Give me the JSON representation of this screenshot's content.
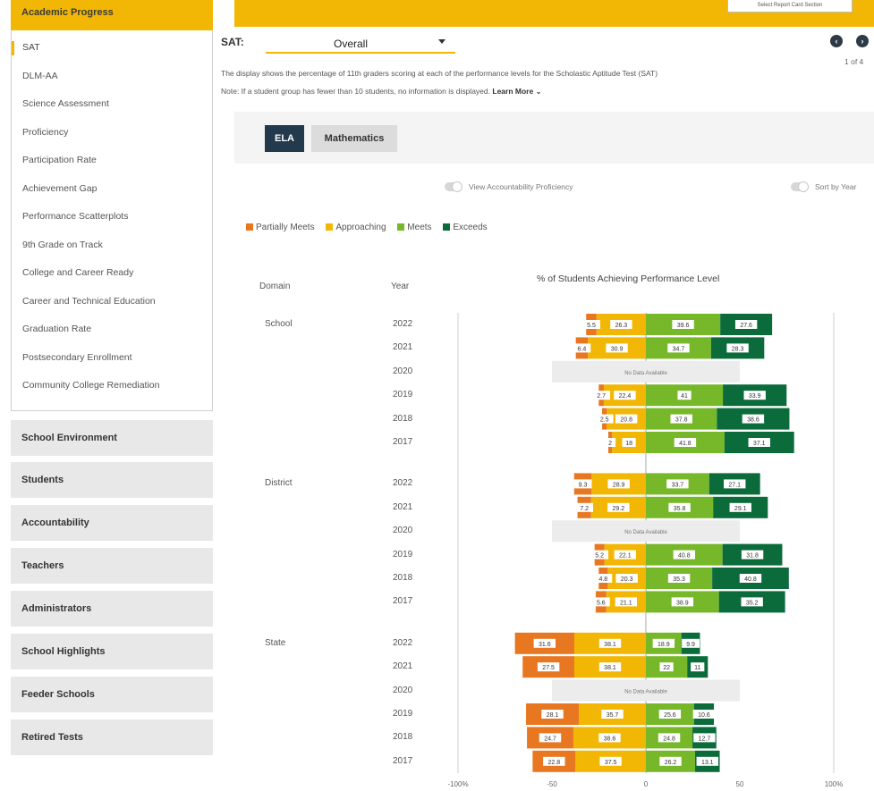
{
  "sidebar": {
    "section_title": "Academic Progress",
    "items": [
      {
        "label": "SAT",
        "active": true
      },
      {
        "label": "DLM-AA"
      },
      {
        "label": "Science Assessment"
      },
      {
        "label": "Proficiency"
      },
      {
        "label": "Participation Rate"
      },
      {
        "label": "Achievement Gap"
      },
      {
        "label": "Performance Scatterplots"
      },
      {
        "label": "9th Grade on Track"
      },
      {
        "label": "College and Career Ready"
      },
      {
        "label": "Career and Technical Education"
      },
      {
        "label": "Graduation Rate"
      },
      {
        "label": "Postsecondary Enrollment"
      },
      {
        "label": "Community College Remediation"
      }
    ],
    "categories": [
      "School Environment",
      "Students",
      "Accountability",
      "Teachers",
      "Administrators",
      "School Highlights",
      "Feeder Schools",
      "Retired Tests"
    ]
  },
  "header": {
    "report_button": "Select Report Card Section"
  },
  "selector": {
    "label": "SAT:",
    "value": "Overall",
    "page_info": "1 of 4"
  },
  "description": "The display shows the percentage of 11th graders scoring at each of the performance levels for the Scholastic Aptitude Test (SAT)",
  "note": "Note: If a student group has fewer than 10 students, no information is displayed.",
  "learn_more": "Learn More ⌄",
  "tabs": [
    {
      "label": "ELA",
      "active": true
    },
    {
      "label": "Mathematics",
      "active": false
    }
  ],
  "toggles": {
    "accountability": "View Accountability Proficiency",
    "sort": "Sort by Year"
  },
  "table_headers": {
    "domain": "Domain",
    "year": "Year"
  },
  "chart_data": {
    "type": "bar",
    "stacked": "diverging",
    "title": "% of Students Achieving Performance Level",
    "xlim": [
      -100,
      100
    ],
    "x_ticks": [
      "-100%",
      "-50",
      "0",
      "50",
      "100%"
    ],
    "legend_position": "top-left",
    "colors": {
      "Partially Meets": "#e87722",
      "Approaching": "#f2b705",
      "Meets": "#76b82a",
      "Exceeds": "#0b6b3a",
      "no_data": "#ececec"
    },
    "series_order": [
      "Partially Meets",
      "Approaching",
      "Meets",
      "Exceeds"
    ],
    "no_data_label": "No Data Available",
    "groups": [
      {
        "domain": "School",
        "rows": [
          {
            "year": "2022",
            "values": [
              5.5,
              26.3,
              39.6,
              27.6
            ]
          },
          {
            "year": "2021",
            "values": [
              6.4,
              30.9,
              34.7,
              28.3
            ]
          },
          {
            "year": "2020",
            "no_data": true
          },
          {
            "year": "2019",
            "values": [
              2.7,
              22.4,
              41,
              33.9
            ]
          },
          {
            "year": "2018",
            "values": [
              2.5,
              20.8,
              37.8,
              38.6
            ]
          },
          {
            "year": "2017",
            "values": [
              2,
              18,
              41.8,
              37.1
            ]
          }
        ]
      },
      {
        "domain": "District",
        "rows": [
          {
            "year": "2022",
            "values": [
              9.3,
              28.9,
              33.7,
              27.1
            ]
          },
          {
            "year": "2021",
            "values": [
              7.2,
              29.2,
              35.8,
              29.1
            ]
          },
          {
            "year": "2020",
            "no_data": true
          },
          {
            "year": "2019",
            "values": [
              5.2,
              22.1,
              40.8,
              31.8
            ]
          },
          {
            "year": "2018",
            "values": [
              4.8,
              20.3,
              35.3,
              40.8
            ]
          },
          {
            "year": "2017",
            "values": [
              5.6,
              21.1,
              38.9,
              35.2
            ]
          }
        ]
      },
      {
        "domain": "State",
        "rows": [
          {
            "year": "2022",
            "values": [
              31.6,
              38.1,
              18.9,
              9.9
            ]
          },
          {
            "year": "2021",
            "values": [
              27.5,
              38.1,
              22,
              11
            ]
          },
          {
            "year": "2020",
            "no_data": true
          },
          {
            "year": "2019",
            "values": [
              28.1,
              35.7,
              25.6,
              10.6
            ]
          },
          {
            "year": "2018",
            "values": [
              24.7,
              38.6,
              24.8,
              12.7
            ]
          },
          {
            "year": "2017",
            "values": [
              22.8,
              37.5,
              26.2,
              13.1
            ]
          }
        ]
      }
    ]
  }
}
